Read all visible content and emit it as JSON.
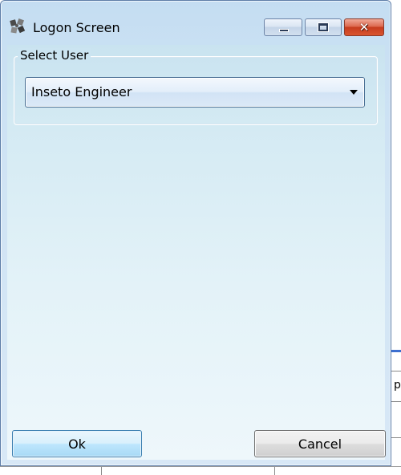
{
  "window": {
    "title": "Logon Screen",
    "icon": "logon-puzzle-icon",
    "caption": {
      "minimize_icon": "minimize-icon",
      "maximize_icon": "maximize-icon",
      "close_icon": "close-icon",
      "close_glyph": "✕"
    }
  },
  "user_group": {
    "legend": "Select User",
    "selected_user": "Inseto Engineer"
  },
  "buttons": {
    "ok_label": "Ok",
    "cancel_label": "Cancel"
  },
  "background": {
    "partial_text": "p"
  },
  "colors": {
    "close_button": "#d9552f",
    "ok_button_border": "#3c7fb1",
    "window_border": "#5d7da8"
  }
}
